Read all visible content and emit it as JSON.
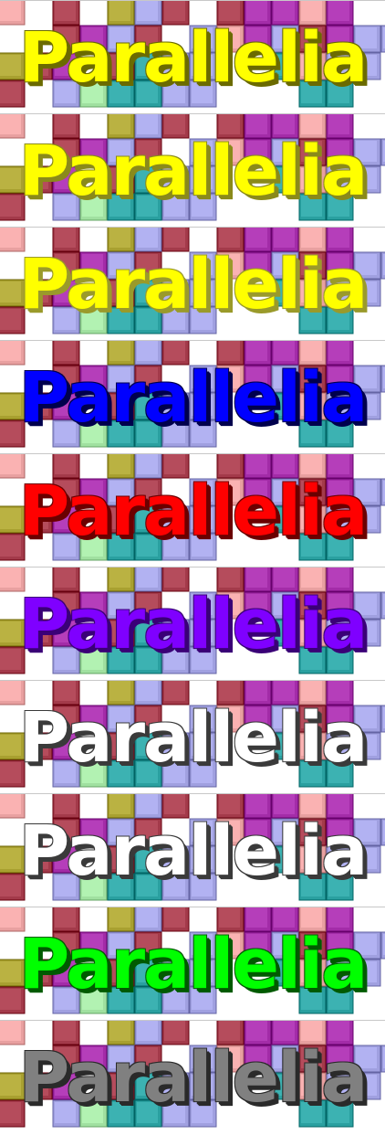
{
  "banners": [
    {
      "title": "Parallelia",
      "text_color": "#ffff00",
      "shadow_color": "#6b6b00"
    },
    {
      "title": "Parallelia",
      "text_color": "#ffff00",
      "shadow_color": "#8a8a1a"
    },
    {
      "title": "Parallelia",
      "text_color": "#ffff00",
      "shadow_color": "#9a9a2a"
    },
    {
      "title": "Parallelia",
      "text_color": "#0000ff",
      "shadow_color": "#00004d"
    },
    {
      "title": "Parallelia",
      "text_color": "#ff0000",
      "shadow_color": "#6b0000"
    },
    {
      "title": "Parallelia",
      "text_color": "#7f00ff",
      "shadow_color": "#3a0077"
    },
    {
      "title": "Parallelia",
      "text_color": "#ffffff",
      "shadow_color": "#3a3a3a"
    },
    {
      "title": "Parallelia",
      "text_color": "#ffffff",
      "shadow_color": "#3a3a3a"
    },
    {
      "title": "Parallelia",
      "text_color": "#00ff00",
      "shadow_color": "#005a00"
    },
    {
      "title": "Parallelia",
      "text_color": "#808080",
      "shadow_color": "#2a2a2a"
    }
  ],
  "background_colors": {
    "maroon": "#a33a4a",
    "pink": "#e8a0a0",
    "olive": "#a8a030",
    "purple": "#a32ca8",
    "lavender": "#a0a0e0",
    "teal": "#2aa0a0",
    "mint": "#a0e0a0"
  }
}
